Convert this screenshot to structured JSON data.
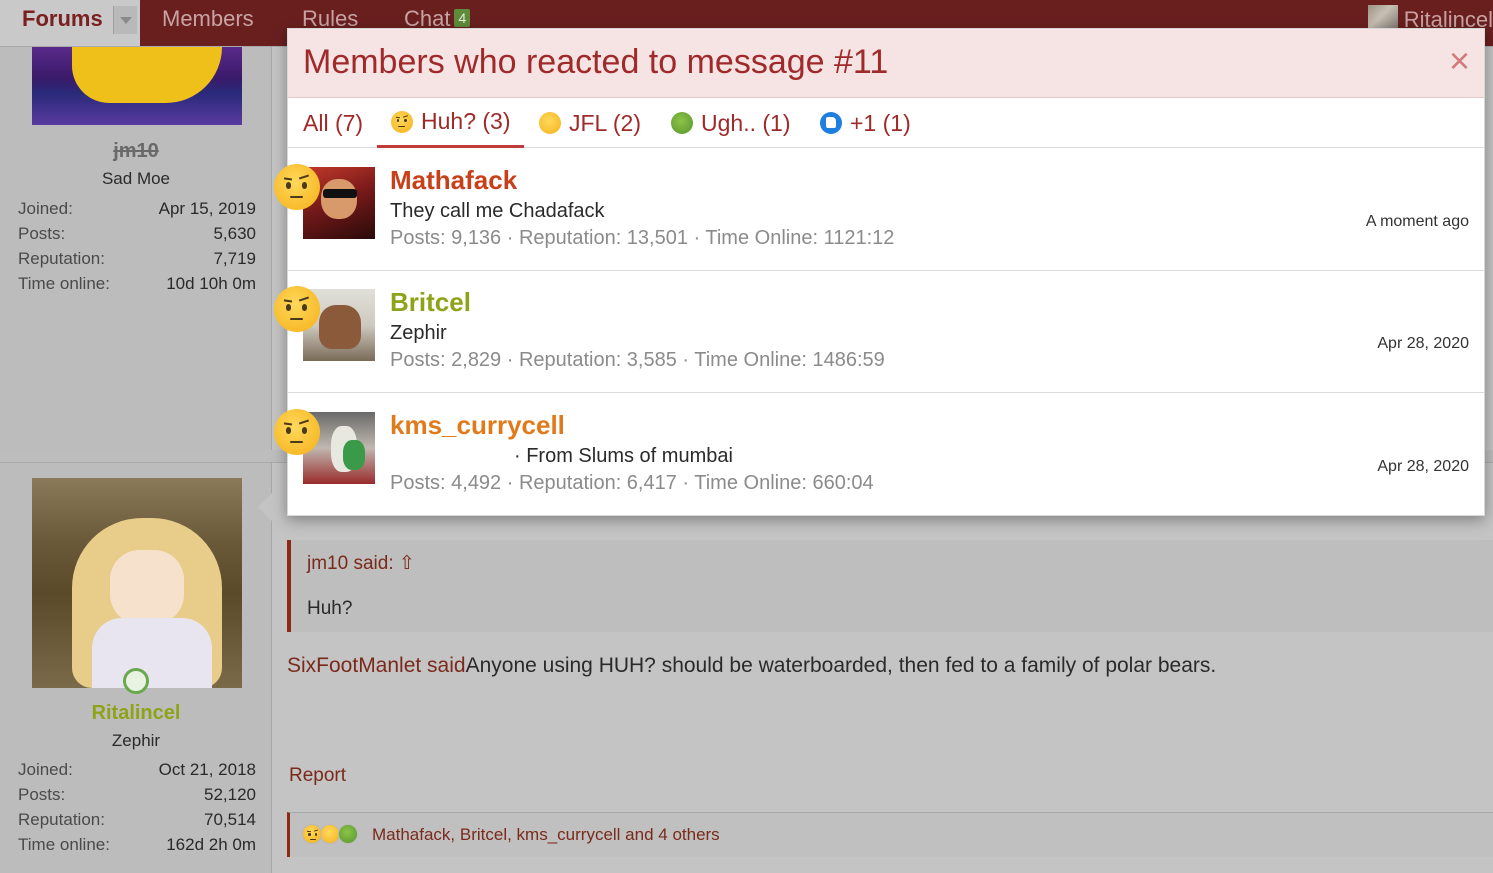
{
  "nav": {
    "tabs": [
      {
        "label": "Forums"
      },
      {
        "label": "Members"
      },
      {
        "label": "Rules"
      },
      {
        "label": "Chat",
        "badge": "4"
      }
    ],
    "user": "Ritalincel"
  },
  "post1": {
    "username": "jm10",
    "user_title": "Sad Moe",
    "stats": [
      {
        "label": "Joined:",
        "value": "Apr 15, 2019"
      },
      {
        "label": "Posts:",
        "value": "5,630"
      },
      {
        "label": "Reputation:",
        "value": "7,719"
      },
      {
        "label": "Time online:",
        "value": "10d 10h 0m"
      }
    ]
  },
  "post2": {
    "username": "Ritalincel",
    "user_title": "Zephir",
    "stats": [
      {
        "label": "Joined:",
        "value": "Oct 21, 2018"
      },
      {
        "label": "Posts:",
        "value": "52,120"
      },
      {
        "label": "Reputation:",
        "value": "70,514"
      },
      {
        "label": "Time online:",
        "value": "162d 2h 0m"
      }
    ],
    "quote": {
      "by": "jm10 said:",
      "body": "Huh?"
    },
    "text_link": "SixFootManlet said",
    "text_body": "Anyone using HUH? should be waterboarded, then fed to a family of polar bears.",
    "report": "Report",
    "reactions_summary": "Mathafack, Britcel, kms_currycell and 4 others"
  },
  "modal": {
    "title": "Members who reacted to message #11",
    "close": "×",
    "tabs": [
      {
        "label": "All (7)",
        "emoji": ""
      },
      {
        "label": "Huh? (3)",
        "emoji": "huh"
      },
      {
        "label": "JFL (2)",
        "emoji": "jfl"
      },
      {
        "label": "Ugh.. (1)",
        "emoji": "ugh"
      },
      {
        "label": "+1 (1)",
        "emoji": "plus-one"
      }
    ],
    "active_tab": "Huh? (3)",
    "rows": [
      {
        "name": "Mathafack",
        "name_color": "#c8401a",
        "title": "They call me Chadafack",
        "stats": "Posts: 9,136 · Reputation: 13,501 · Time Online: 1121:12",
        "time": "A moment ago",
        "emoji": "huh"
      },
      {
        "name": "Britcel",
        "name_color": "#8fa318",
        "title": "Zephir",
        "stats": "Posts: 2,829 · Reputation: 3,585 · Time Online: 1486:59",
        "time": "Apr 28, 2020",
        "emoji": "huh"
      },
      {
        "name": "kms_currycell",
        "name_color": "#e07a1a",
        "title": "· From Slums of mumbai",
        "stats": "Posts: 4,492 · Reputation: 6,417 · Time Online: 660:04",
        "time": "Apr 28, 2020",
        "emoji": "huh"
      }
    ]
  },
  "colors": {
    "nav_bg": "#6a1f1f",
    "accent": "#a02a2a",
    "modal_header_bg": "#f6e3e3"
  }
}
